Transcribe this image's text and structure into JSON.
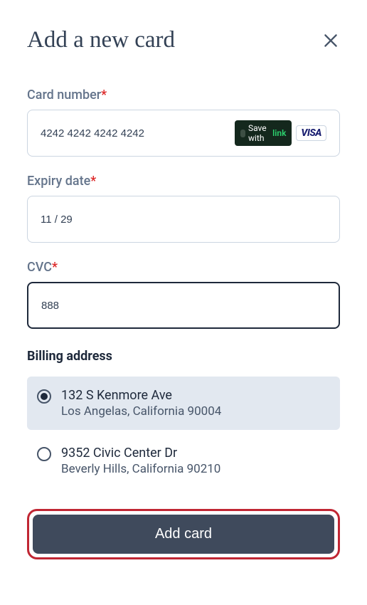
{
  "header": {
    "title": "Add a new card"
  },
  "fields": {
    "card_number": {
      "label": "Card number",
      "required_marker": "*",
      "value": "4242 4242 4242 4242",
      "save_with_text": "Save with",
      "link_text": "link",
      "brand": "VISA"
    },
    "expiry": {
      "label": "Expiry date",
      "required_marker": "*",
      "value": "11 / 29"
    },
    "cvc": {
      "label": "CVC",
      "required_marker": "*",
      "value": "888"
    }
  },
  "billing": {
    "heading": "Billing address",
    "addresses": [
      {
        "line1": "132 S Kenmore Ave",
        "line2": "Los Angelas, California 90004",
        "selected": true
      },
      {
        "line1": "9352 Civic Center Dr",
        "line2": "Beverly Hills, California 90210",
        "selected": false
      }
    ]
  },
  "submit_label": "Add card"
}
